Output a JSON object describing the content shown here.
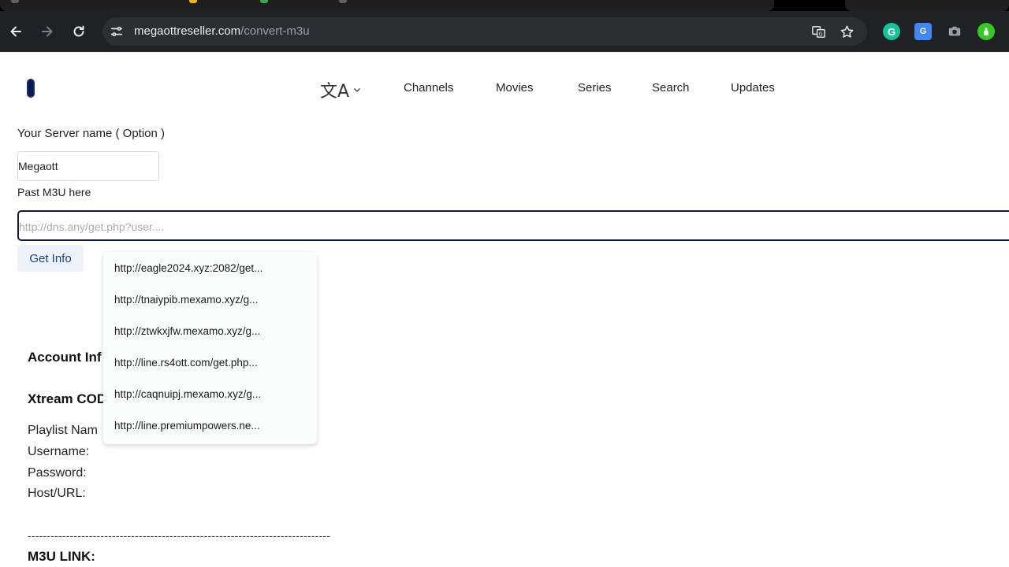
{
  "browser": {
    "url_domain": "megaottreseller.com",
    "url_path": "/convert-m3u"
  },
  "header": {
    "nav": [
      "Channels",
      "Movies",
      "Series",
      "Search",
      "Updates"
    ]
  },
  "form": {
    "server_label": "Your Server name ( Option )",
    "server_value": "Megaott",
    "m3u_label": "Past M3U here",
    "m3u_placeholder": "http://dns.any/get.php?user....",
    "get_info_label": "Get Info"
  },
  "autocomplete": [
    "http://eagle2024.xyz:2082/get...",
    "http://tnaiypib.mexamo.xyz/g...",
    "http://ztwkxjfw.mexamo.xyz/g...",
    "http://line.rs4ott.com/get.php...",
    "http://caqnuipj.mexamo.xyz/g...",
    "http://line.premiumpowers.ne..."
  ],
  "results": {
    "account_info_heading": "Account Inf",
    "xtream_heading": "Xtream COD",
    "playlist_name_label": "Playlist Nam",
    "username_label": "Username:",
    "password_label": "Password:",
    "host_label": "Host/URL:",
    "divider": "-------------------------------------------------------------------------------",
    "m3u_link_heading": "M3U LINK:"
  },
  "colors": {
    "chrome_bg": "#202124",
    "omnibox_bg": "#2d2e31",
    "input_focus_border": "#111a3a",
    "button_bg": "#eef3fb",
    "button_text": "#1d3f7a"
  },
  "icons": [
    "back-arrow-icon",
    "forward-arrow-icon",
    "reload-icon",
    "site-settings-icon",
    "translate-icon",
    "bookmark-star-icon",
    "grammarly-icon",
    "google-translate-icon",
    "camera-icon",
    "extension-icon",
    "language-icon",
    "chevron-down-icon"
  ]
}
